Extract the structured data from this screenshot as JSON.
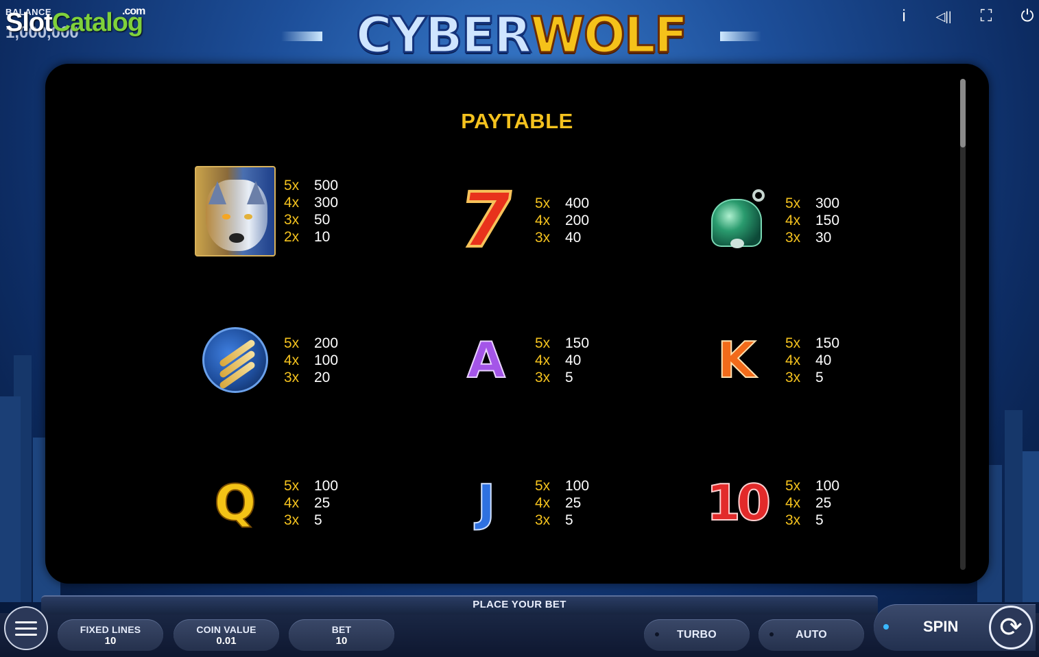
{
  "watermark": {
    "slot": "Slot",
    "catalog": "Catalog",
    "com": ".com"
  },
  "balance": {
    "label": "BALANCE",
    "value": "1,000,000"
  },
  "logo": {
    "cyber": "CYBER",
    "wolf": "WOLF"
  },
  "top_icons": [
    {
      "name": "info-icon",
      "glyph": "i"
    },
    {
      "name": "sound-icon",
      "glyph": "◁||"
    },
    {
      "name": "fullscreen-icon",
      "glyph": "⛶"
    },
    {
      "name": "power-icon",
      "glyph": "⏻"
    }
  ],
  "paytable": {
    "title": "PAYTABLE",
    "symbols": [
      {
        "symbol": "wolf",
        "payouts": [
          {
            "mult": "5x",
            "value": "500"
          },
          {
            "mult": "4x",
            "value": "300"
          },
          {
            "mult": "3x",
            "value": "50"
          },
          {
            "mult": "2x",
            "value": "10"
          }
        ]
      },
      {
        "symbol": "seven",
        "label": "7",
        "payouts": [
          {
            "mult": "5x",
            "value": "400"
          },
          {
            "mult": "4x",
            "value": "200"
          },
          {
            "mult": "3x",
            "value": "40"
          }
        ]
      },
      {
        "symbol": "bell",
        "payouts": [
          {
            "mult": "5x",
            "value": "300"
          },
          {
            "mult": "4x",
            "value": "150"
          },
          {
            "mult": "3x",
            "value": "30"
          }
        ]
      },
      {
        "symbol": "claw",
        "payouts": [
          {
            "mult": "5x",
            "value": "200"
          },
          {
            "mult": "4x",
            "value": "100"
          },
          {
            "mult": "3x",
            "value": "20"
          }
        ]
      },
      {
        "symbol": "A",
        "label": "A",
        "payouts": [
          {
            "mult": "5x",
            "value": "150"
          },
          {
            "mult": "4x",
            "value": "40"
          },
          {
            "mult": "3x",
            "value": "5"
          }
        ]
      },
      {
        "symbol": "K",
        "label": "K",
        "payouts": [
          {
            "mult": "5x",
            "value": "150"
          },
          {
            "mult": "4x",
            "value": "40"
          },
          {
            "mult": "3x",
            "value": "5"
          }
        ]
      },
      {
        "symbol": "Q",
        "label": "Q",
        "payouts": [
          {
            "mult": "5x",
            "value": "100"
          },
          {
            "mult": "4x",
            "value": "25"
          },
          {
            "mult": "3x",
            "value": "5"
          }
        ]
      },
      {
        "symbol": "J",
        "label": "J",
        "payouts": [
          {
            "mult": "5x",
            "value": "100"
          },
          {
            "mult": "4x",
            "value": "25"
          },
          {
            "mult": "3x",
            "value": "5"
          }
        ]
      },
      {
        "symbol": "10",
        "label": "10",
        "payouts": [
          {
            "mult": "5x",
            "value": "100"
          },
          {
            "mult": "4x",
            "value": "25"
          },
          {
            "mult": "3x",
            "value": "5"
          }
        ]
      }
    ]
  },
  "bottom": {
    "status": "PLACE YOUR BET",
    "fixed_lines": {
      "label": "FIXED LINES",
      "value": "10"
    },
    "coin_value": {
      "label": "COIN VALUE",
      "value": "0.01"
    },
    "bet": {
      "label": "BET",
      "value": "10"
    },
    "turbo": "TURBO",
    "auto": "AUTO",
    "spin": "SPIN"
  },
  "colors": {
    "accent": "#f4c21e",
    "panel": "#000000",
    "spin_dot": "#3ab8ff"
  }
}
